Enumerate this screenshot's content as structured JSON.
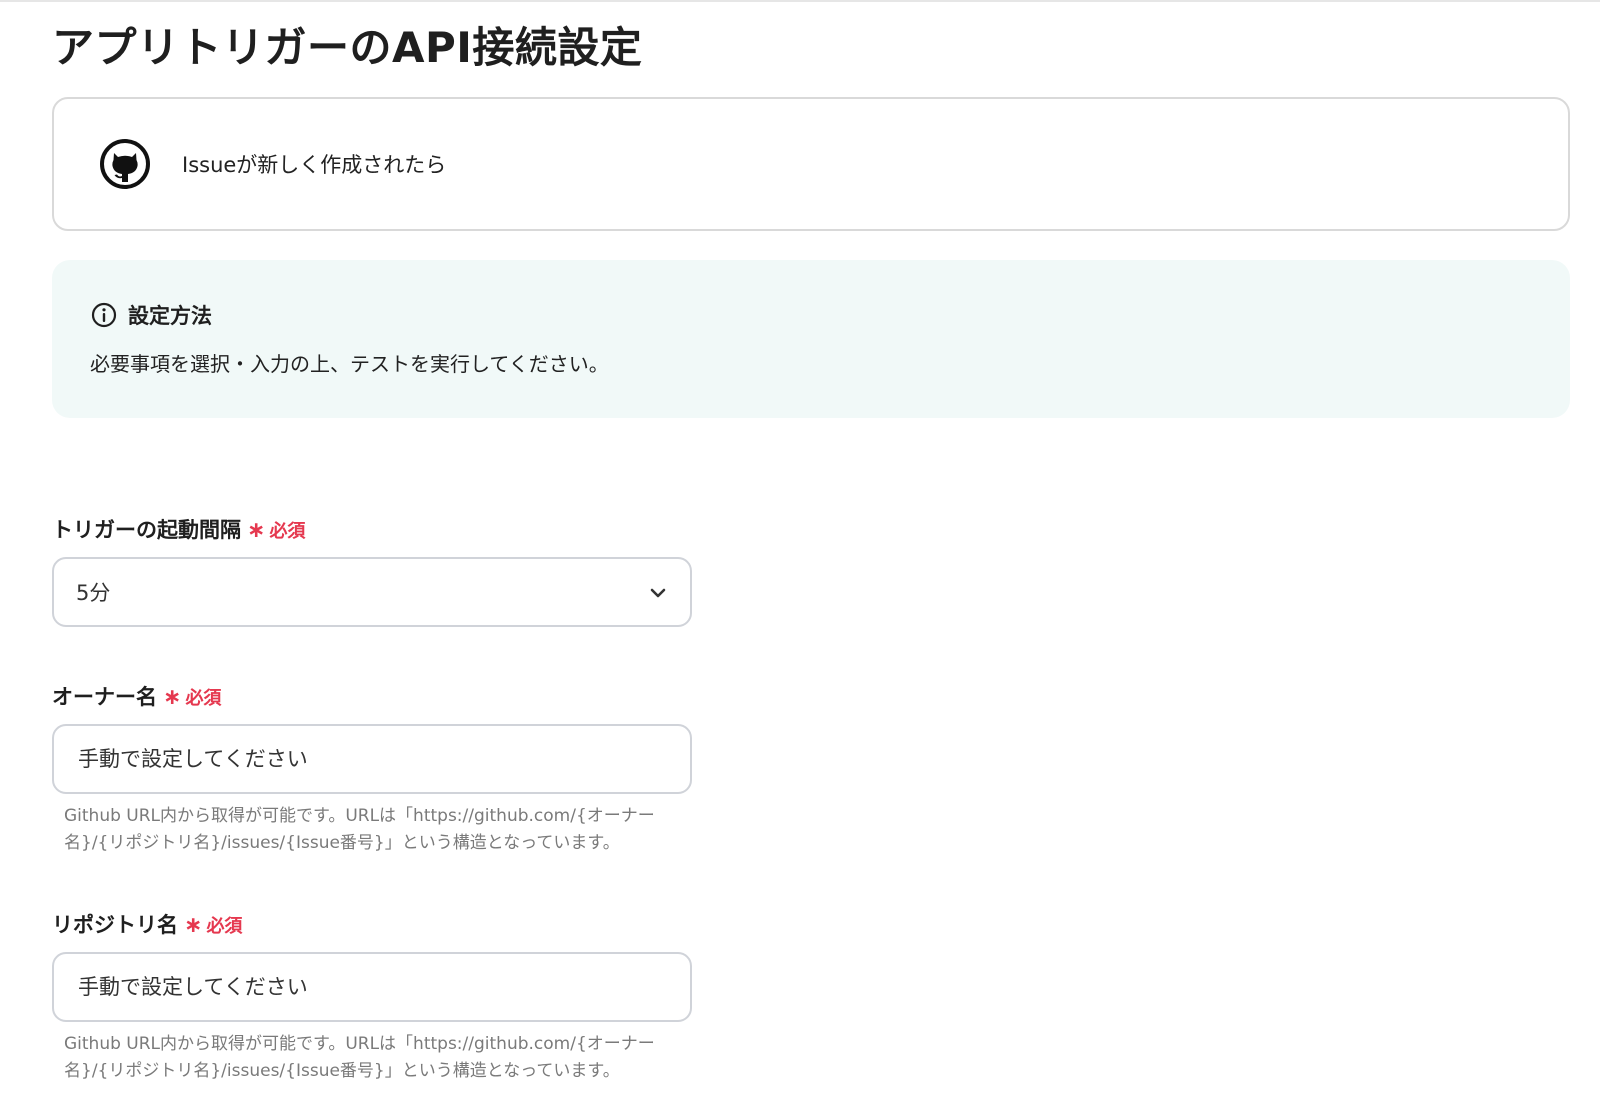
{
  "page": {
    "title": "アプリトリガーのAPI接続設定"
  },
  "trigger": {
    "label": "Issueが新しく作成されたら",
    "icon": "github-icon"
  },
  "info": {
    "title": "設定方法",
    "description": "必要事項を選択・入力の上、テストを実行してください。",
    "icon": "info-circle-icon"
  },
  "fields": {
    "interval": {
      "label": "トリガーの起動間隔",
      "required_mark": "∗",
      "required_text": "必須",
      "selected_value": "5分"
    },
    "owner": {
      "label": "オーナー名",
      "required_mark": "∗",
      "required_text": "必須",
      "placeholder": "手動で設定してください",
      "hint": "Github URL内から取得が可能です。URLは「https://github.com/{オーナー名}/{リポジトリ名}/issues/{Issue番号}」という構造となっています。"
    },
    "repository": {
      "label": "リポジトリ名",
      "required_mark": "∗",
      "required_text": "必須",
      "placeholder": "手動で設定してください",
      "hint": "Github URL内から取得が可能です。URLは「https://github.com/{オーナー名}/{リポジトリ名}/issues/{Issue番号}」という構造となっています。"
    }
  },
  "colors": {
    "required": "#e5384f",
    "info_bg": "#f1f9f8",
    "border": "#d9d9d9"
  }
}
